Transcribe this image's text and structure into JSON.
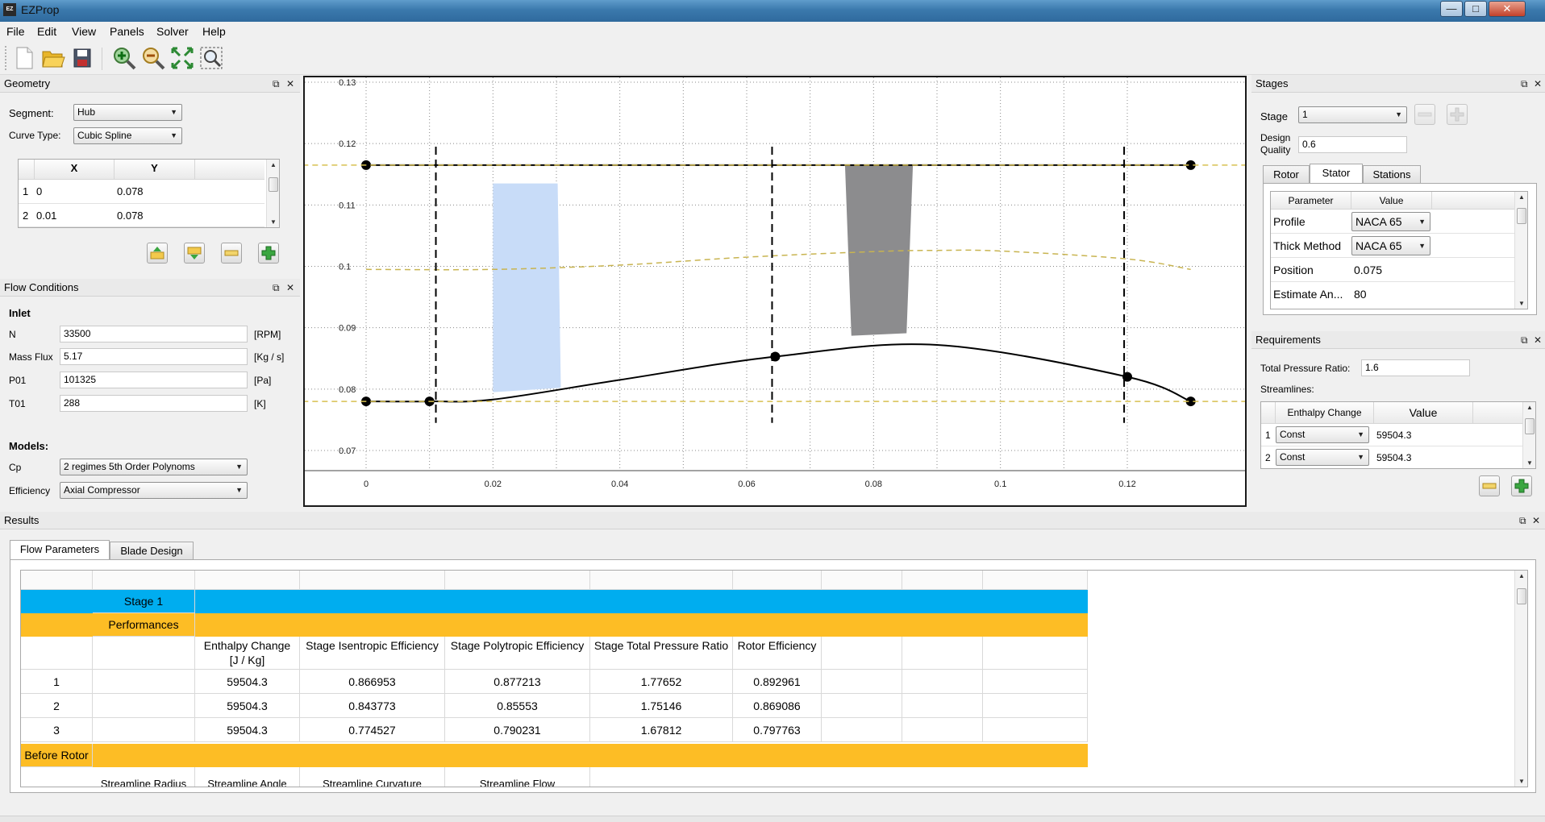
{
  "window": {
    "title": "EZProp",
    "logo_text": "EZ",
    "minimize": "—",
    "maximize": "□",
    "close": "✕"
  },
  "menu": [
    "File",
    "Edit",
    "View",
    "Panels",
    "Solver",
    "Help"
  ],
  "toolbar": {
    "icons": [
      "new-file-icon",
      "open-folder-icon",
      "save-icon",
      "zoom-in-icon",
      "zoom-out-icon",
      "zoom-fit-icon",
      "zoom-select-icon"
    ]
  },
  "panel_controls": {
    "float": "⧉",
    "close": "✕"
  },
  "geometry": {
    "title": "Geometry",
    "segment_label": "Segment:",
    "segment_value": "Hub",
    "curve_type_label": "Curve Type:",
    "curve_type_value": "Cubic Spline",
    "columns": [
      "X",
      "Y"
    ],
    "rows": [
      {
        "n": "1",
        "x": "0",
        "y": "0.078"
      },
      {
        "n": "2",
        "x": "0.01",
        "y": "0.078"
      }
    ]
  },
  "flow": {
    "title": "Flow Conditions",
    "inlet_label": "Inlet",
    "fields": [
      {
        "label": "N",
        "value": "33500",
        "unit": "[RPM]"
      },
      {
        "label": "Mass Flux",
        "value": "5.17",
        "unit": "[Kg / s]"
      },
      {
        "label": "P01",
        "value": "101325",
        "unit": "[Pa]"
      },
      {
        "label": "T01",
        "value": "288",
        "unit": "[K]"
      }
    ],
    "models_label": "Models:",
    "cp_label": "Cp",
    "cp_value": "2 regimes 5th Order Polynoms",
    "eff_label": "Efficiency",
    "eff_value": "Axial Compressor"
  },
  "chart_data": {
    "type": "line",
    "title": "",
    "xlabel": "",
    "ylabel": "",
    "xlim": [
      0,
      0.13
    ],
    "ylim": [
      0.07,
      0.13
    ],
    "x_ticks": [
      "0",
      "0.02",
      "0.04",
      "0.06",
      "0.08",
      "0.1",
      "0.12"
    ],
    "x_tick_values": [
      0,
      0.02,
      0.04,
      0.06,
      0.08,
      0.1,
      0.12
    ],
    "y_ticks": [
      "0.07",
      "0.08",
      "0.09",
      "0.1",
      "0.11",
      "0.12",
      "0.13"
    ],
    "y_tick_values": [
      0.07,
      0.08,
      0.09,
      0.1,
      0.11,
      0.12,
      0.13
    ],
    "grid": true,
    "series": [
      {
        "role": "shroud",
        "x": [
          0,
          0.13
        ],
        "y": [
          0.1165,
          0.1165
        ],
        "markers": true,
        "color": "#000000"
      },
      {
        "role": "hub",
        "x": [
          0,
          0.01,
          0.02,
          0.04,
          0.0645,
          0.09,
          0.12,
          0.13
        ],
        "y": [
          0.078,
          0.078,
          0.0783,
          0.0815,
          0.0853,
          0.0872,
          0.082,
          0.078
        ],
        "markers_x": [
          0,
          0.01,
          0.0645,
          0.12,
          0.13
        ],
        "markers_y": [
          0.078,
          0.078,
          0.0853,
          0.082,
          0.078
        ],
        "color": "#000000"
      },
      {
        "role": "mean",
        "x": [
          0,
          0.02,
          0.04,
          0.06,
          0.08,
          0.09,
          0.1,
          0.12,
          0.13
        ],
        "y": [
          0.0995,
          0.0995,
          0.1002,
          0.1015,
          0.1024,
          0.1026,
          0.1025,
          0.1012,
          0.0995
        ],
        "dashed": true,
        "color": "#c8b450"
      },
      {
        "role": "hub-ext",
        "x": [
          -0.01,
          0.14
        ],
        "y": [
          0.078,
          0.078
        ],
        "dashed": true,
        "color": "#d8c050"
      },
      {
        "role": "shroud-ext",
        "x": [
          -0.01,
          0.14
        ],
        "y": [
          0.1165,
          0.1165
        ],
        "dashed": true,
        "color": "#d8c050"
      }
    ],
    "stations_x": [
      0.011,
      0.064,
      0.1195
    ],
    "rotor_blade": {
      "polygon": [
        [
          0.02,
          0.1135
        ],
        [
          0.0302,
          0.1135
        ],
        [
          0.0307,
          0.0802
        ],
        [
          0.02,
          0.0795
        ]
      ],
      "color": "#c8dcf8"
    },
    "stator_blade": {
      "polygon": [
        [
          0.0755,
          0.1165
        ],
        [
          0.0862,
          0.1165
        ],
        [
          0.0852,
          0.0891
        ],
        [
          0.0765,
          0.0887
        ]
      ],
      "color": "#8c8c8e"
    }
  },
  "stages": {
    "title": "Stages",
    "stage_label": "Stage",
    "stage_value": "1",
    "design_quality_label_1": "Design",
    "design_quality_label_2": "Quality",
    "design_quality_value": "0.6",
    "tabs": [
      "Rotor",
      "Stator",
      "Stations"
    ],
    "columns": [
      "Parameter",
      "Value"
    ],
    "rows": [
      {
        "param": "Profile",
        "value": "NACA 65",
        "combo": true
      },
      {
        "param": "Thick Method",
        "value": "NACA 65",
        "combo": true
      },
      {
        "param": "Position",
        "value": "0.075",
        "combo": false
      },
      {
        "param": "Estimate An...",
        "value": "80",
        "combo": false
      }
    ]
  },
  "requirements": {
    "title": "Requirements",
    "tpr_label": "Total Pressure Ratio:",
    "tpr_value": "1.6",
    "streamlines_label": "Streamlines:",
    "columns": [
      "Enthalpy Change",
      "Value"
    ],
    "rows": [
      {
        "n": "1",
        "mode": "Const",
        "value": "59504.3"
      },
      {
        "n": "2",
        "mode": "Const",
        "value": "59504.3"
      }
    ]
  },
  "results": {
    "title": "Results",
    "tabs": [
      "Flow Parameters",
      "Blade Design"
    ],
    "stage_row": "Stage 1",
    "performances_row": "Performances",
    "headers": [
      "Enthalpy Change [J / Kg]",
      "Stage Isentropic Efficiency",
      "Stage Polytropic Efficiency",
      "Stage Total Pressure Ratio",
      "Rotor Efficiency"
    ],
    "enthalpy_header_1": "Enthalpy Change",
    "enthalpy_header_2": "[J / Kg]",
    "rows": [
      {
        "n": "1",
        "v": [
          "59504.3",
          "0.866953",
          "0.877213",
          "1.77652",
          "0.892961"
        ]
      },
      {
        "n": "2",
        "v": [
          "59504.3",
          "0.843773",
          "0.85553",
          "1.75146",
          "0.869086"
        ]
      },
      {
        "n": "3",
        "v": [
          "59504.3",
          "0.774527",
          "0.790231",
          "1.67812",
          "0.797763"
        ]
      }
    ],
    "before_rotor_row": "Before Rotor",
    "partial_headers": [
      "Streamline Radius",
      "Streamline Angle",
      "Streamline Curvature",
      "Streamline Flow"
    ]
  },
  "colors": {
    "stage_row": "#00adef",
    "section_row": "#fdbd25",
    "title_bar": "#3b79ad"
  }
}
